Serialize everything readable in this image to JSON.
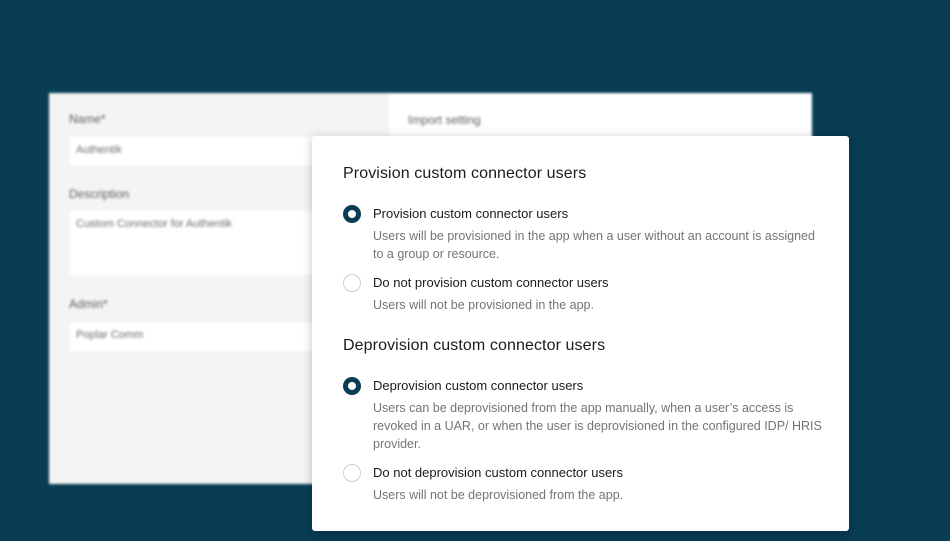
{
  "background_form": {
    "name_label": "Name*",
    "name_value": "Authentik",
    "description_label": "Description",
    "description_value": "Custom Connector for Authentik",
    "admin_label": "Admin*",
    "admin_value": "Poplar Comm",
    "import_setting_label": "Import setting"
  },
  "provision": {
    "title": "Provision custom connector users",
    "options": [
      {
        "label": "Provision custom connector users",
        "description": "Users will be provisioned in the app when a user without an account is assigned to a group or resource.",
        "selected": true
      },
      {
        "label": "Do not provision custom connector users",
        "description": "Users will not be provisioned in the app.",
        "selected": false
      }
    ]
  },
  "deprovision": {
    "title": "Deprovision custom connector users",
    "options": [
      {
        "label": "Deprovision custom connector users",
        "description": "Users can be deprovisioned from the app manually, when a user’s access is revoked in a UAR, or when the user is deprovisioned in the configured IDP/ HRIS provider.",
        "selected": true
      },
      {
        "label": "Do not deprovision custom connector users",
        "description": "Users will not be deprovisioned from the app.",
        "selected": false
      }
    ]
  },
  "colors": {
    "background": "#083d54",
    "accent": "#083d54"
  }
}
